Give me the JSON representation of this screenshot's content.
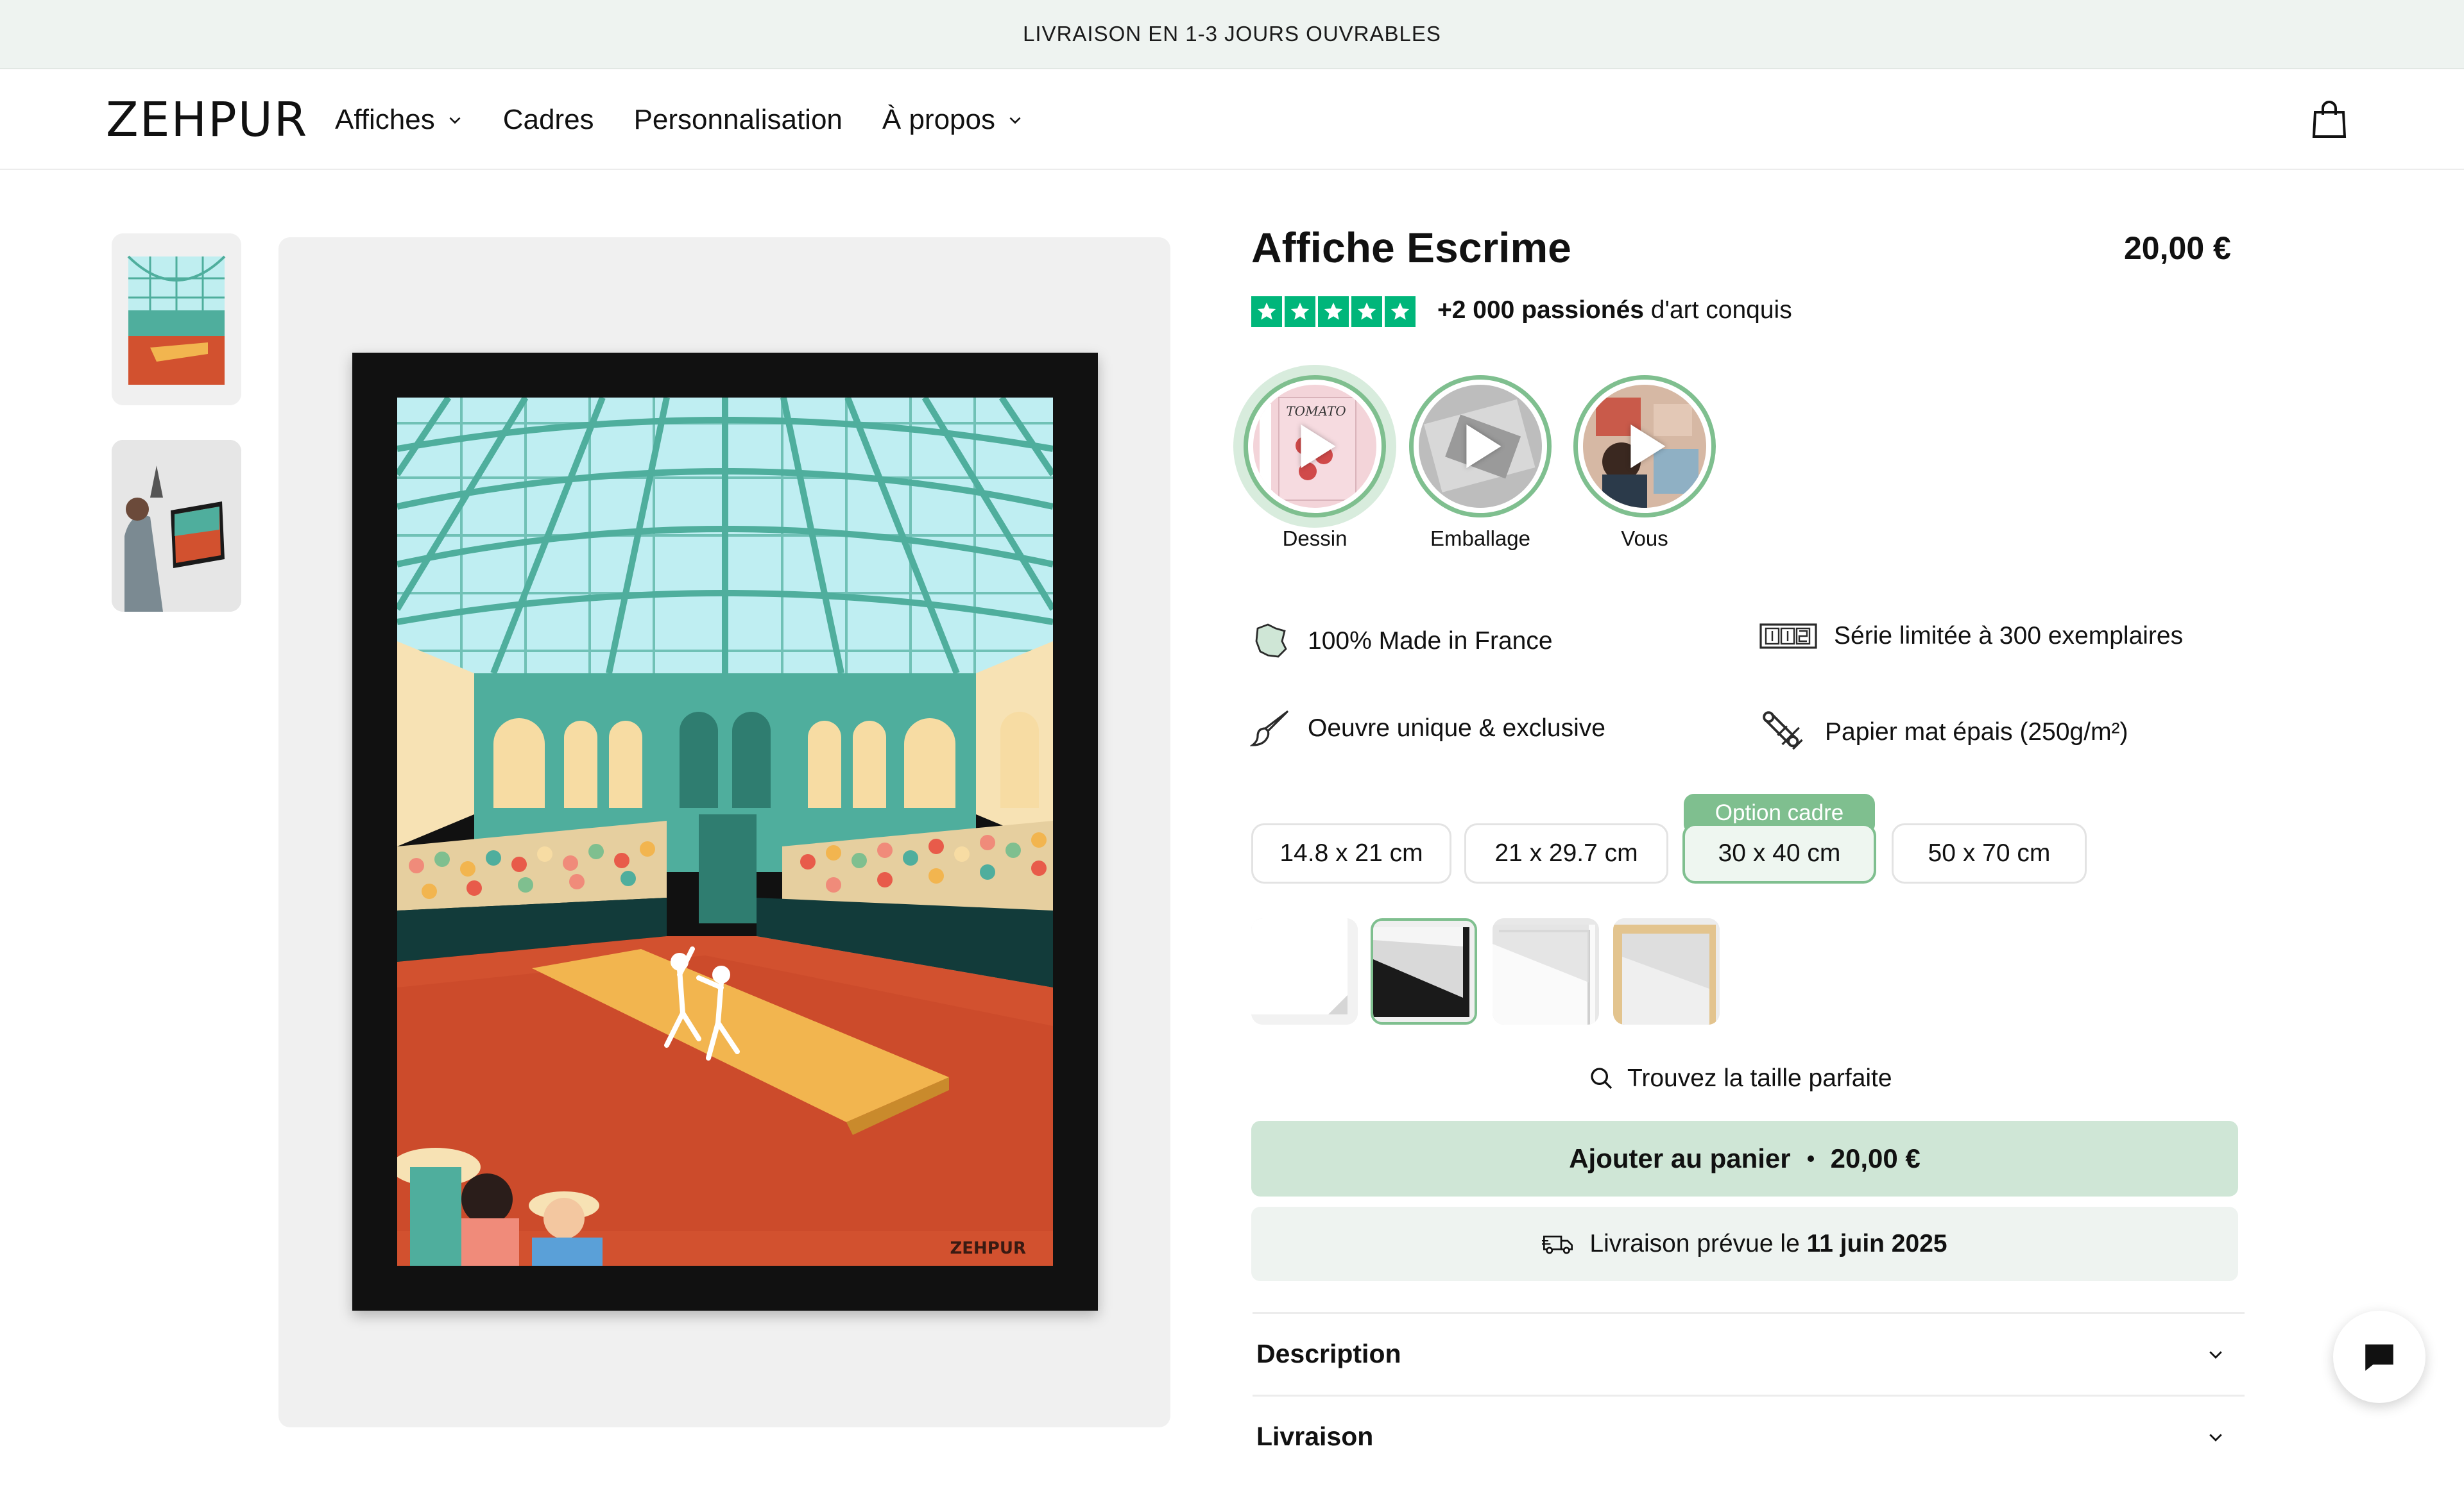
{
  "announcement": "LIVRAISON EN 1-3 JOURS OUVRABLES",
  "header": {
    "logo": "ZEHPUR",
    "nav": [
      "Affiches",
      "Cadres",
      "Personnalisation",
      "À propos"
    ]
  },
  "product": {
    "title": "Affiche Escrime",
    "price": "20,00 €",
    "reviews_bold": "+2 000 passionés",
    "reviews_rest": " d'art conquis",
    "stories": [
      "Dessin",
      "Emballage",
      "Vous"
    ],
    "features": [
      "100% Made in France",
      "Série limitée à 300 exemplaires",
      "Oeuvre unique & exclusive",
      "Papier mat épais (250g/m²)"
    ],
    "sizes": [
      "14.8 x 21 cm",
      "21 x 29.7 cm",
      "30 x 40 cm",
      "50 x 70 cm"
    ],
    "option_badge": "Option cadre",
    "find_size": "Trouvez la taille parfaite",
    "add_to_cart": "Ajouter au panier",
    "add_to_cart_price": "20,00 €",
    "delivery_prefix": "Livraison prévue le ",
    "delivery_date": "11 juin 2025",
    "accordions": [
      "Description",
      "Livraison"
    ],
    "artwork_signature": "ZEHPUR",
    "story_image_text": "TOMATO"
  },
  "colors": {
    "accent_green": "#7fbf8f",
    "cart_button": "#cfe6d6",
    "trustpilot": "#00b67a",
    "announcement_bg": "#eef3f0"
  }
}
